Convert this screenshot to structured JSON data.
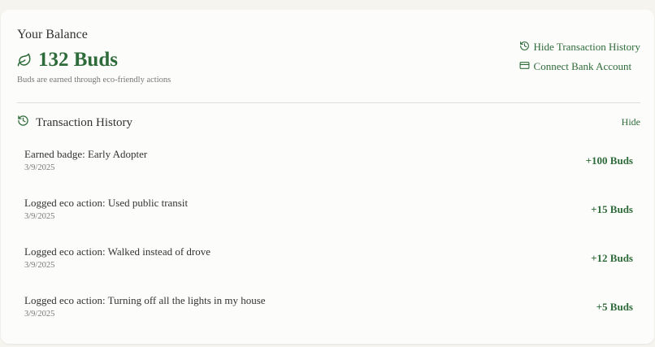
{
  "balance": {
    "title": "Your Balance",
    "amount": "132 Buds",
    "note": "Buds are earned through eco-friendly actions"
  },
  "actions": {
    "hide_history": "Hide Transaction History",
    "connect_bank": "Connect Bank Account"
  },
  "history": {
    "title": "Transaction History",
    "hide_label": "Hide",
    "transactions": [
      {
        "description": "Earned badge: Early Adopter",
        "date": "3/9/2025",
        "amount": "+100 Buds"
      },
      {
        "description": "Logged eco action: Used public transit",
        "date": "3/9/2025",
        "amount": "+15 Buds"
      },
      {
        "description": "Logged eco action: Walked instead of drove",
        "date": "3/9/2025",
        "amount": "+12 Buds"
      },
      {
        "description": "Logged eco action: Turning off all the lights in my house",
        "date": "3/9/2025",
        "amount": "+5 Buds"
      }
    ]
  },
  "icons": {
    "leaf": "leaf-icon",
    "history": "history-icon",
    "card": "credit-card-icon"
  },
  "colors": {
    "accent": "#2e6b3a",
    "background": "#f5f4ef",
    "card": "#fcfcfa"
  }
}
